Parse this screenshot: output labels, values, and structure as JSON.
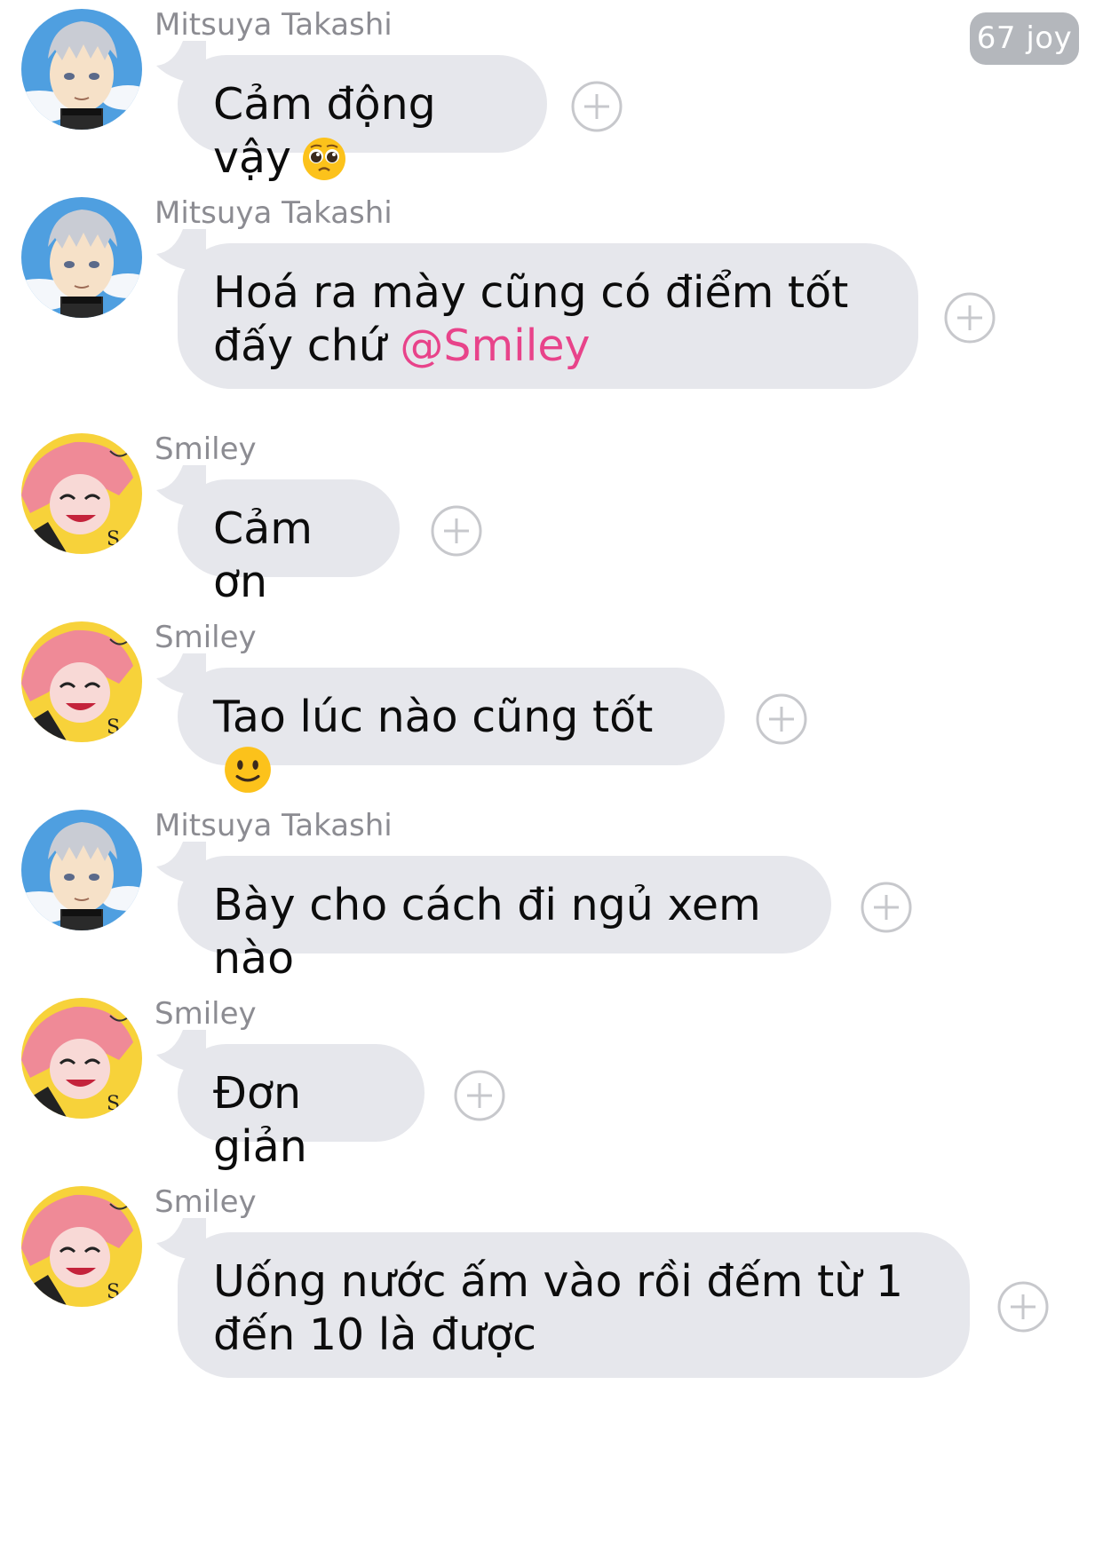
{
  "badge": {
    "label": "67 joy"
  },
  "messages": [
    {
      "sender": "Mitsuya Takashi",
      "text": "Cảm động vậy",
      "mention": "",
      "emoji": "pleading-face",
      "avatar": "mitsuya"
    },
    {
      "sender": "Mitsuya Takashi",
      "text": "Hoá ra mày cũng có điểm tốt đấy chứ ",
      "mention": "@Smiley",
      "emoji": "",
      "avatar": "mitsuya"
    },
    {
      "sender": "Smiley",
      "text": "Cảm ơn",
      "mention": "",
      "emoji": "",
      "avatar": "smiley"
    },
    {
      "sender": "Smiley",
      "text": "Tao lúc nào cũng tốt",
      "mention": "",
      "emoji": "slightly-smiling-face",
      "avatar": "smiley"
    },
    {
      "sender": "Mitsuya Takashi",
      "text": "Bày cho cách đi ngủ xem nào",
      "mention": "",
      "emoji": "",
      "avatar": "mitsuya"
    },
    {
      "sender": "Smiley",
      "text": "Đơn giản",
      "mention": "",
      "emoji": "",
      "avatar": "smiley"
    },
    {
      "sender": "Smiley",
      "text": "Uống nước ấm vào rồi đếm từ 1 đến 10 là được",
      "mention": "",
      "emoji": "",
      "avatar": "smiley"
    }
  ],
  "icons": {
    "add_reaction": "plus-circle-icon",
    "avatar_mitsuya": "avatar-mitsuya",
    "avatar_smiley": "avatar-smiley"
  },
  "colors": {
    "bubble": "#e6e7ec",
    "sender": "#8c8c92",
    "mention": "#e8438a",
    "badge": "#b4b7bc"
  }
}
